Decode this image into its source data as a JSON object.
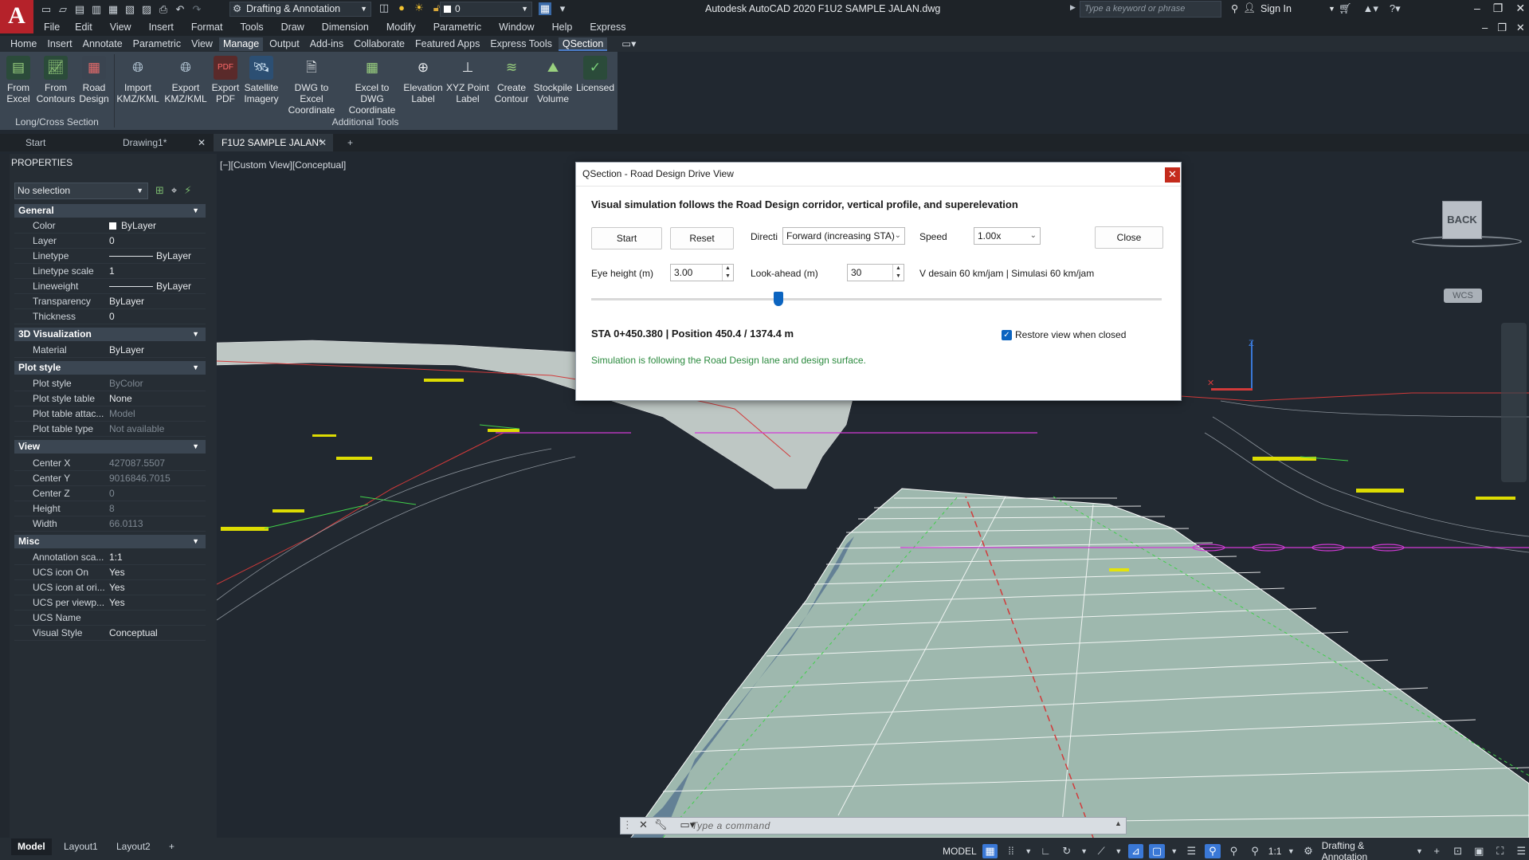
{
  "titlebar": {
    "workspace": "Drafting & Annotation",
    "layer": "0",
    "title": "Autodesk AutoCAD 2020    F1U2 SAMPLE JALAN.dwg",
    "search_placeholder": "Type a keyword or phrase",
    "sign_in": "Sign In"
  },
  "menu": [
    "File",
    "Edit",
    "View",
    "Insert",
    "Format",
    "Tools",
    "Draw",
    "Dimension",
    "Modify",
    "Parametric",
    "Window",
    "Help",
    "Express"
  ],
  "ribbon_tabs": [
    "Home",
    "Insert",
    "Annotate",
    "Parametric",
    "View",
    "Manage",
    "Output",
    "Add-ins",
    "Collaborate",
    "Featured Apps",
    "Express Tools",
    "QSection"
  ],
  "ribbon": {
    "buttons": [
      {
        "line1": "From",
        "line2": "Excel"
      },
      {
        "line1": "From",
        "line2": "Contours"
      },
      {
        "line1": "Road",
        "line2": "Design"
      },
      {
        "line1": "Import",
        "line2": "KMZ/KML"
      },
      {
        "line1": "Export",
        "line2": "KMZ/KML"
      },
      {
        "line1": "Export",
        "line2": "PDF"
      },
      {
        "line1": "Satellite",
        "line2": "Imagery"
      },
      {
        "line1": "DWG to Excel",
        "line2": "Coordinate"
      },
      {
        "line1": "Excel to DWG",
        "line2": "Coordinate"
      },
      {
        "line1": "Elevation",
        "line2": "Label"
      },
      {
        "line1": "XYZ Point",
        "line2": "Label"
      },
      {
        "line1": "Create",
        "line2": "Contour"
      },
      {
        "line1": "Stockpile",
        "line2": "Volume"
      },
      {
        "line1": "Licensed",
        "line2": ""
      }
    ],
    "panel_1": "Long/Cross Section",
    "panel_2": "Additional Tools"
  },
  "doc_tabs": [
    "Start",
    "Drawing1*",
    "F1U2 SAMPLE JALAN*"
  ],
  "properties": {
    "title": "PROPERTIES",
    "selection": "No selection",
    "general": {
      "title": "General",
      "rows": [
        {
          "name": "Color",
          "value": "ByLayer"
        },
        {
          "name": "Layer",
          "value": "0"
        },
        {
          "name": "Linetype",
          "value": "ByLayer"
        },
        {
          "name": "Linetype scale",
          "value": "1"
        },
        {
          "name": "Lineweight",
          "value": "ByLayer"
        },
        {
          "name": "Transparency",
          "value": "ByLayer"
        },
        {
          "name": "Thickness",
          "value": "0"
        }
      ]
    },
    "vis3d": {
      "title": "3D Visualization",
      "rows": [
        {
          "name": "Material",
          "value": "ByLayer"
        }
      ]
    },
    "plot": {
      "title": "Plot style",
      "rows": [
        {
          "name": "Plot style",
          "value": "ByColor"
        },
        {
          "name": "Plot style table",
          "value": "None"
        },
        {
          "name": "Plot table attac...",
          "value": "Model"
        },
        {
          "name": "Plot table type",
          "value": "Not available"
        }
      ]
    },
    "view": {
      "title": "View",
      "rows": [
        {
          "name": "Center X",
          "value": "427087.5507"
        },
        {
          "name": "Center Y",
          "value": "9016846.7015"
        },
        {
          "name": "Center Z",
          "value": "0"
        },
        {
          "name": "Height",
          "value": "8"
        },
        {
          "name": "Width",
          "value": "66.0113"
        }
      ]
    },
    "misc": {
      "title": "Misc",
      "rows": [
        {
          "name": "Annotation sca...",
          "value": "1:1"
        },
        {
          "name": "UCS icon On",
          "value": "Yes"
        },
        {
          "name": "UCS icon at ori...",
          "value": "Yes"
        },
        {
          "name": "UCS per viewp...",
          "value": "Yes"
        },
        {
          "name": "UCS Name",
          "value": ""
        },
        {
          "name": "Visual Style",
          "value": "Conceptual"
        }
      ]
    }
  },
  "viewport": {
    "label": "[−][Custom View][Conceptual]",
    "viewcube": "BACK",
    "wcs": "WCS",
    "ucs_z": "Z"
  },
  "dialog": {
    "title": "QSection - Road Design Drive View",
    "description": "Visual simulation follows the Road Design corridor, vertical profile, and superelevation",
    "start": "Start",
    "reset": "Reset",
    "direction_label": "Directi",
    "direction_value": "Forward (increasing STA)",
    "speed_label": "Speed",
    "speed_value": "1.00x",
    "close": "Close",
    "eye_height_label": "Eye height (m)",
    "eye_height_value": "3.00",
    "lookahead_label": "Look-ahead (m)",
    "lookahead_value": "30",
    "speed_info": "V desain 60 km/jam  |  Simulasi 60 km/jam",
    "progress": 0.328,
    "status": "STA 0+450.380    |    Position 450.4 / 1374.4 m",
    "restore_label": "Restore view when closed",
    "message": "Simulation is following the Road Design lane and design surface."
  },
  "command": {
    "placeholder": "Type a command"
  },
  "status": {
    "layout_tabs": [
      "Model",
      "Layout1",
      "Layout2"
    ],
    "model": "MODEL",
    "scale": "1:1",
    "workspace": "Drafting & Annotation"
  }
}
